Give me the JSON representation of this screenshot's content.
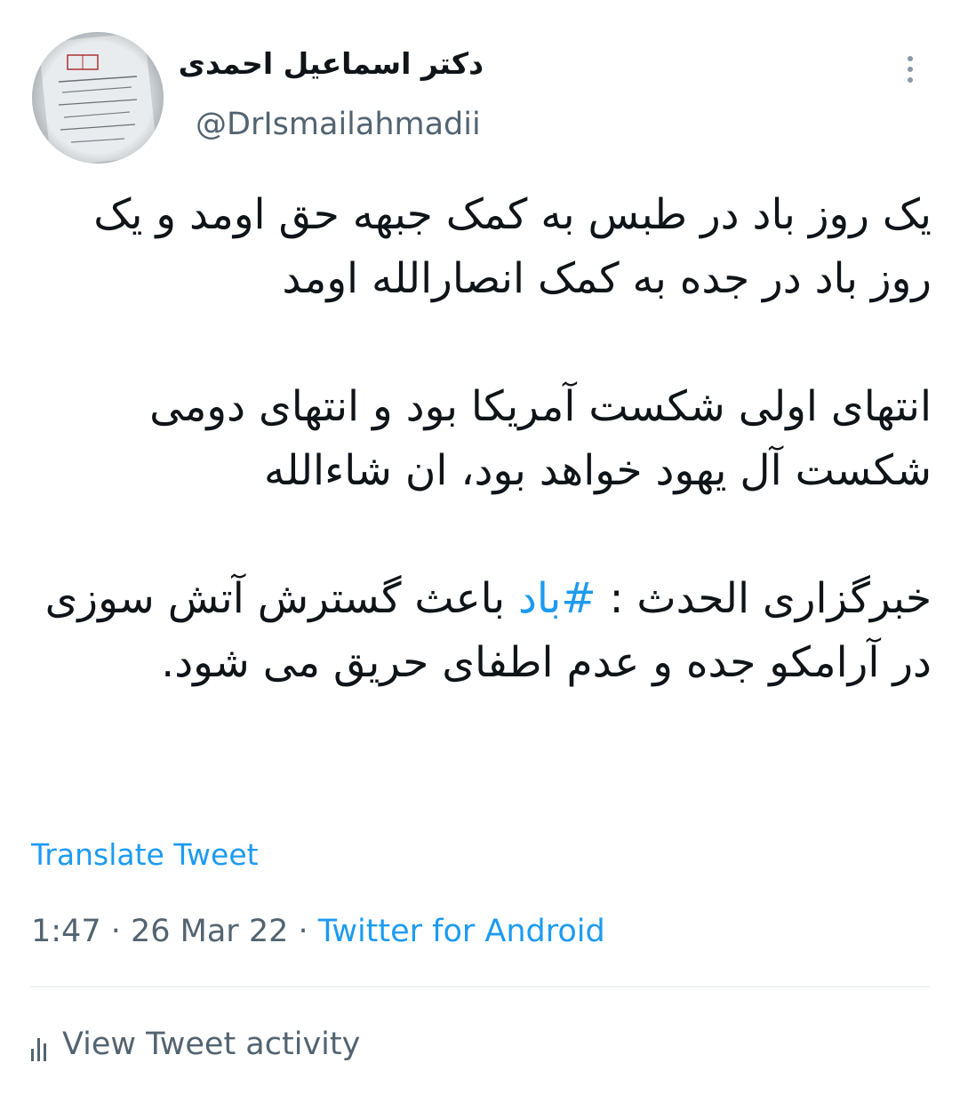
{
  "author": {
    "display_name": "دکتر اسماعیل احمدی",
    "handle": "@DrIsmailahmadii"
  },
  "tweet": {
    "paragraphs": [
      {
        "lines": [
          "یک روز باد در طبس به کمک جبهه حق اومد و یک روز باد در جده به کمک انصارالله اومد"
        ]
      },
      {
        "lines": [
          "انتهای اولی شکست آمریکا بود و انتهای دومی شکست آل یهود خواهد بود، ان شاءالله"
        ]
      },
      {
        "prefix": "خبرگزاری الحدث : ",
        "hashtag": "#باد",
        "suffix": " باعث گسترش آتش سوزی در آرامکو جده و عدم اطفای حریق می شود."
      }
    ]
  },
  "actions": {
    "translate_label": "Translate Tweet",
    "view_activity_label": "View Tweet activity"
  },
  "meta": {
    "time": "1:47",
    "separator": " · ",
    "date": "26 Mar 22",
    "source": "Twitter for Android"
  },
  "colors": {
    "link": "#1d9bf0",
    "secondary_text": "#536471",
    "primary_text": "#0f1419"
  },
  "icons": {
    "more": "more-vertical-icon",
    "activity": "bar-chart-icon"
  }
}
